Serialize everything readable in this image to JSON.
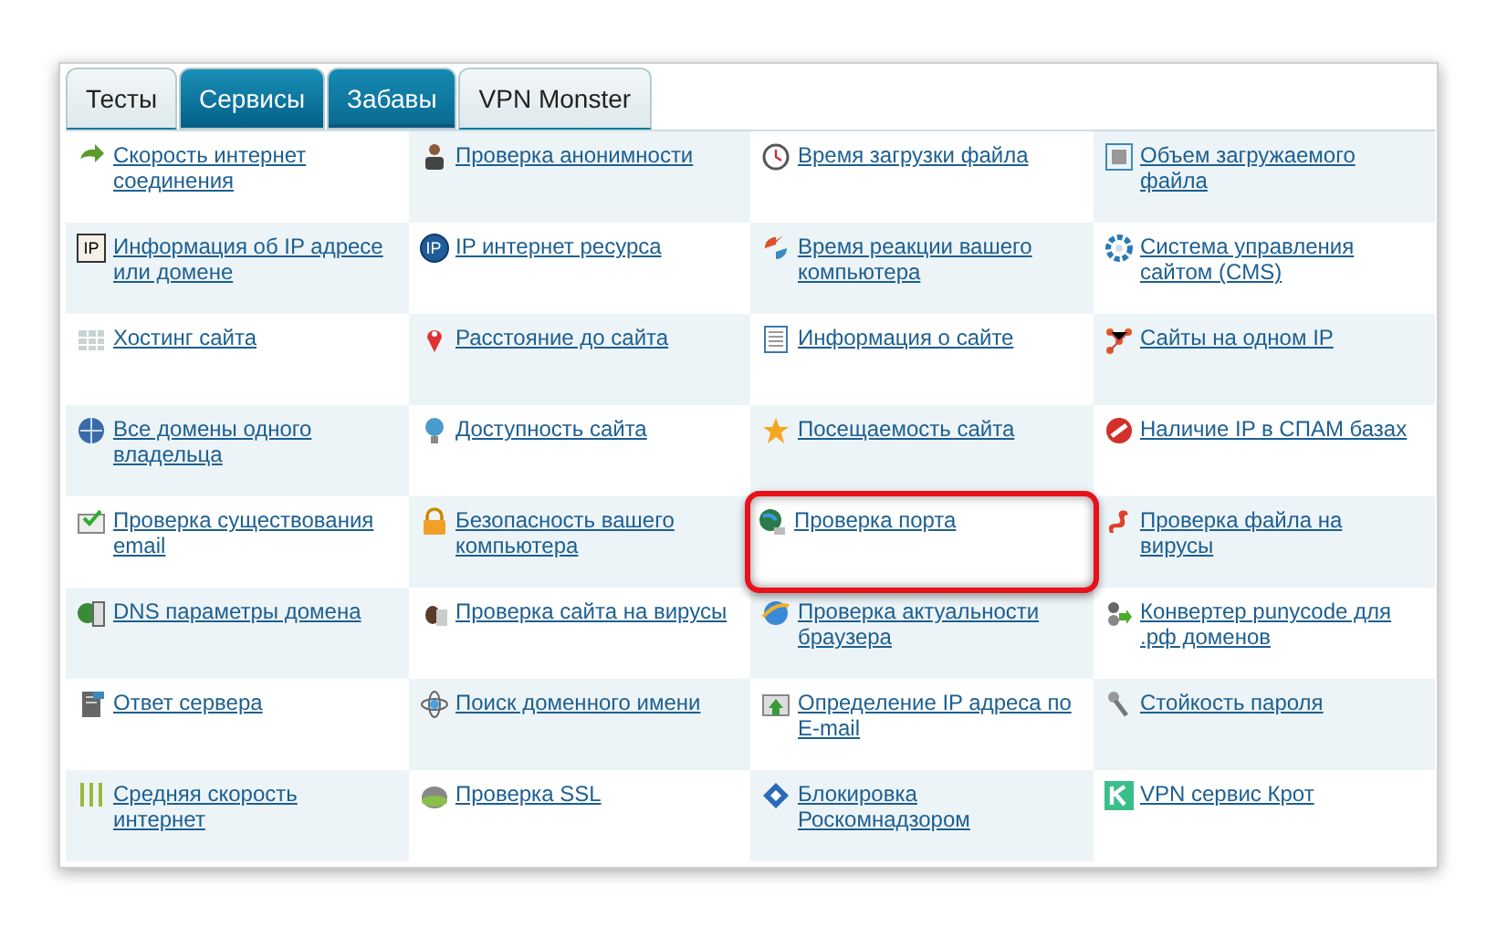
{
  "tabs": [
    {
      "label": "Тесты",
      "selected": false,
      "highlighted": false
    },
    {
      "label": "Сервисы",
      "selected": true,
      "highlighted": false
    },
    {
      "label": "Забавы",
      "selected": false,
      "highlighted": true
    },
    {
      "label": "VPN Monster",
      "selected": false,
      "highlighted": false
    }
  ],
  "links": [
    {
      "label": "Скорость интернет соединения",
      "highlighted": false
    },
    {
      "label": "Проверка анонимности",
      "highlighted": false
    },
    {
      "label": "Время загрузки файла",
      "highlighted": false
    },
    {
      "label": "Объем загружаемого файла",
      "highlighted": false
    },
    {
      "label": "Информация об IP адресе или домене",
      "highlighted": false,
      "icon_text": "IP"
    },
    {
      "label": "IP интернет ресурса",
      "highlighted": false,
      "icon_text": "IP"
    },
    {
      "label": "Время реакции вашего компьютера",
      "highlighted": false
    },
    {
      "label": "Система управления сайтом (CMS)",
      "highlighted": false
    },
    {
      "label": "Хостинг сайта",
      "highlighted": false
    },
    {
      "label": "Расстояние до сайта",
      "highlighted": false
    },
    {
      "label": "Информация о сайте",
      "highlighted": false
    },
    {
      "label": "Сайты на одном IP",
      "highlighted": false
    },
    {
      "label": "Все домены одного владельца",
      "highlighted": false
    },
    {
      "label": "Доступность сайта",
      "highlighted": false
    },
    {
      "label": "Посещаемость сайта",
      "highlighted": false
    },
    {
      "label": "Наличие IP в СПАМ базах",
      "highlighted": false
    },
    {
      "label": "Проверка существования email",
      "highlighted": false
    },
    {
      "label": "Безопасность вашего компьютера",
      "highlighted": false
    },
    {
      "label": "Проверка порта",
      "highlighted": true
    },
    {
      "label": "Проверка файла на вирусы",
      "highlighted": false
    },
    {
      "label": "DNS параметры домена",
      "highlighted": false
    },
    {
      "label": "Проверка сайта на вирусы",
      "highlighted": false
    },
    {
      "label": "Проверка актуальности браузера",
      "highlighted": false
    },
    {
      "label": "Конвертер punycode для .рф доменов",
      "highlighted": false
    },
    {
      "label": "Ответ сервера",
      "highlighted": false
    },
    {
      "label": "Поиск доменного имени",
      "highlighted": false
    },
    {
      "label": "Определение IP адреса по E-mail",
      "highlighted": false
    },
    {
      "label": "Стойкость пароля",
      "highlighted": false
    },
    {
      "label": "Средняя скорость интернет",
      "highlighted": false
    },
    {
      "label": "Проверка SSL",
      "highlighted": false
    },
    {
      "label": "Блокировка Роскомнадзором",
      "highlighted": false
    },
    {
      "label": "VPN сервис Крот",
      "highlighted": false
    }
  ]
}
